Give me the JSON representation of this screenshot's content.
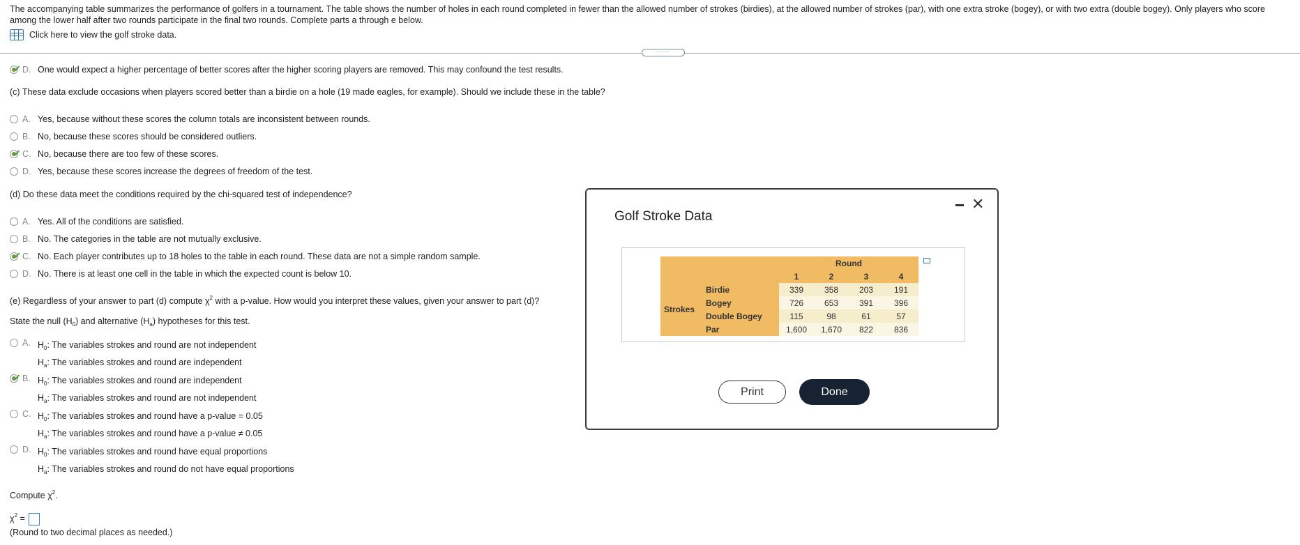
{
  "intro": "The accompanying table summarizes the performance of golfers in a tournament. The table shows the number of holes in each round completed in fewer than the allowed number of strokes (birdies), at the allowed number of strokes (par), with one extra stroke (bogey), or with two extra (double bogey). Only players who score among the lower half after two rounds participate in the final two rounds. Complete parts a through e below.",
  "data_link": "Click here to view the golf stroke data.",
  "partb_d": {
    "letter": "D.",
    "text": "One would expect a higher percentage of better scores after the higher scoring players are removed. This may confound the test results."
  },
  "partc": {
    "question": "(c) These data exclude occasions when players scored better than a birdie on a hole (19 made eagles, for example). Should we include these in the table?",
    "options": [
      {
        "letter": "A.",
        "text": "Yes, because without these scores the column totals are inconsistent between rounds."
      },
      {
        "letter": "B.",
        "text": "No, because these scores should be considered outliers."
      },
      {
        "letter": "C.",
        "text": "No, because there are too few of these scores."
      },
      {
        "letter": "D.",
        "text": "Yes, because these scores increase the degrees of freedom of the test."
      }
    ]
  },
  "partd": {
    "question": "(d) Do these data meet the conditions required by the chi-squared test of independence?",
    "options": [
      {
        "letter": "A.",
        "text": "Yes. All of the conditions are satisfied."
      },
      {
        "letter": "B.",
        "text": "No. The categories in the table are not mutually exclusive."
      },
      {
        "letter": "C.",
        "text": "No. Each player contributes up to 18 holes to the table in each round. These data are not a simple random sample."
      },
      {
        "letter": "D.",
        "text": "No. There is at least one cell in the table in which the expected count is below 10."
      }
    ]
  },
  "parte": {
    "q_pre": "(e) Regardless of your answer to part (d) compute ",
    "q_post": " with a p-value. How would you interpret these values, given your answer to part (d)?",
    "hyp_pre": "State the null (",
    "hyp_mid": ") and alternative (",
    "hyp_post": ") hypotheses for this test.",
    "options": [
      {
        "letter": "A.",
        "h0": ": The variables strokes and round are not independent",
        "ha": ": The variables strokes and round are independent"
      },
      {
        "letter": "B.",
        "h0": ": The variables strokes and round are independent",
        "ha": ": The variables strokes and round are not independent"
      },
      {
        "letter": "C.",
        "h0": ": The variables strokes and round have a p-value = 0.05",
        "ha": ": The variables strokes and round have a p-value ≠ 0.05"
      },
      {
        "letter": "D.",
        "h0": ": The variables strokes and round have equal proportions",
        "ha": ": The variables strokes and round do not have equal proportions"
      }
    ],
    "compute": "Compute ",
    "round_note": "(Round to two decimal places as needed.)"
  },
  "symbols": {
    "H": "H",
    "sub0": "0",
    "suba": "a",
    "chi": "χ",
    "sup2": "2",
    "eq": " =",
    "period": "."
  },
  "modal": {
    "title": "Golf Stroke Data",
    "round_label": "Round",
    "strokes_label": "Strokes",
    "rounds": [
      "1",
      "2",
      "3",
      "4"
    ],
    "rows": [
      {
        "label": "Birdie",
        "values": [
          "339",
          "358",
          "203",
          "191"
        ]
      },
      {
        "label": "Bogey",
        "values": [
          "726",
          "653",
          "391",
          "396"
        ]
      },
      {
        "label": "Double Bogey",
        "values": [
          "115",
          "98",
          "61",
          "57"
        ]
      },
      {
        "label": "Par",
        "values": [
          "1,600",
          "1,670",
          "822",
          "836"
        ]
      }
    ],
    "print_label": "Print",
    "done_label": "Done",
    "close_glyph": "✕"
  }
}
